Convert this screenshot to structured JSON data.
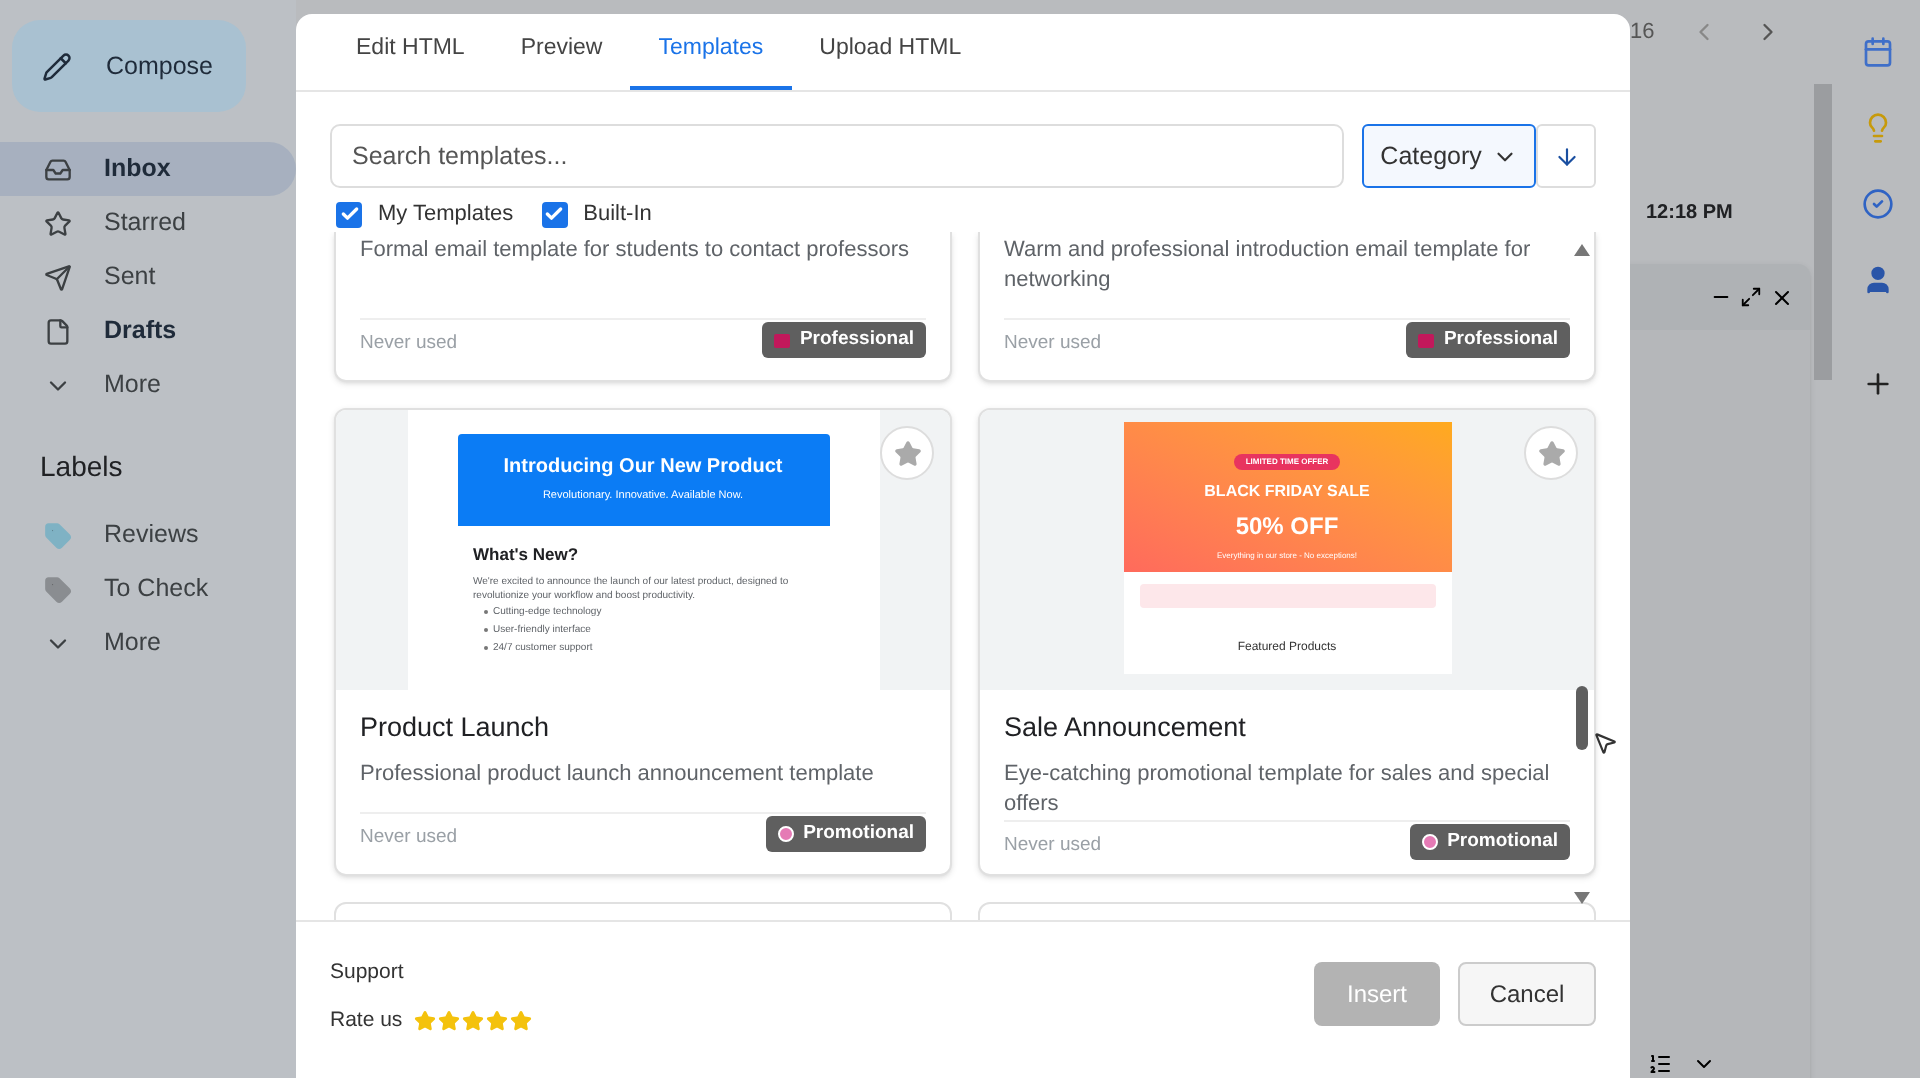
{
  "sidebar": {
    "compose": "Compose",
    "items": [
      {
        "label": "Inbox",
        "kind": "inbox",
        "selected": true,
        "unread": true
      },
      {
        "label": "Starred",
        "kind": "starred",
        "selected": false,
        "unread": false
      },
      {
        "label": "Sent",
        "kind": "sent",
        "selected": false,
        "unread": false
      },
      {
        "label": "Drafts",
        "kind": "drafts",
        "selected": false,
        "unread": true
      },
      {
        "label": "More",
        "kind": "more",
        "selected": false,
        "unread": false
      }
    ],
    "labels_title": "Labels",
    "labels": [
      {
        "label": "Reviews",
        "kind": "label",
        "color": "#7fb2c4"
      },
      {
        "label": "To Check",
        "kind": "label",
        "color": "#8a8d91"
      },
      {
        "label": "More",
        "kind": "more"
      }
    ]
  },
  "mail": {
    "page_fragment": "16",
    "time": "12:18 PM"
  },
  "modal": {
    "tabs": [
      {
        "label": "Edit HTML",
        "selected": false
      },
      {
        "label": "Preview",
        "selected": false
      },
      {
        "label": "Templates",
        "selected": true
      },
      {
        "label": "Upload HTML",
        "selected": false
      }
    ],
    "search": {
      "placeholder": "Search templates..."
    },
    "category": "Category",
    "filters": [
      {
        "label": "My Templates",
        "checked": true
      },
      {
        "label": "Built-In",
        "checked": true
      }
    ],
    "templates": [
      {
        "description": "Formal email template for students to contact professors",
        "usage": "Never used",
        "category": "Professional",
        "kind": "professional"
      },
      {
        "description": "Warm and professional introduction email template for networking",
        "usage": "Never used",
        "category": "Professional",
        "kind": "professional"
      },
      {
        "title": "Product Launch",
        "description": "Professional product launch announcement template",
        "usage": "Never used",
        "category": "Promotional",
        "kind": "promotional",
        "starred": false,
        "preview": {
          "kind": "product",
          "heading": "Introducing Our New Product",
          "tagline": "Revolutionary. Innovative. Available Now.",
          "section": "What's New?",
          "body": "We're excited to announce the launch of our latest product, designed to revolutionize your workflow and boost productivity.",
          "bullets": [
            "Cutting-edge technology",
            "User-friendly interface",
            "24/7 customer support"
          ]
        }
      },
      {
        "title": "Sale Announcement",
        "description": "Eye-catching promotional template for sales and special offers",
        "usage": "Never used",
        "category": "Promotional",
        "kind": "promotional",
        "starred": false,
        "preview": {
          "kind": "sale",
          "badge": "LIMITED TIME OFFER",
          "heading": "BLACK FRIDAY SALE",
          "offer": "50% OFF",
          "tagline": "Everything in our store - No exceptions!",
          "section": "Featured Products"
        }
      }
    ],
    "footer": {
      "support": "Support",
      "rate": "Rate us",
      "stars": 5,
      "insert": {
        "label": "Insert",
        "disabled": true
      },
      "cancel": "Cancel"
    }
  }
}
